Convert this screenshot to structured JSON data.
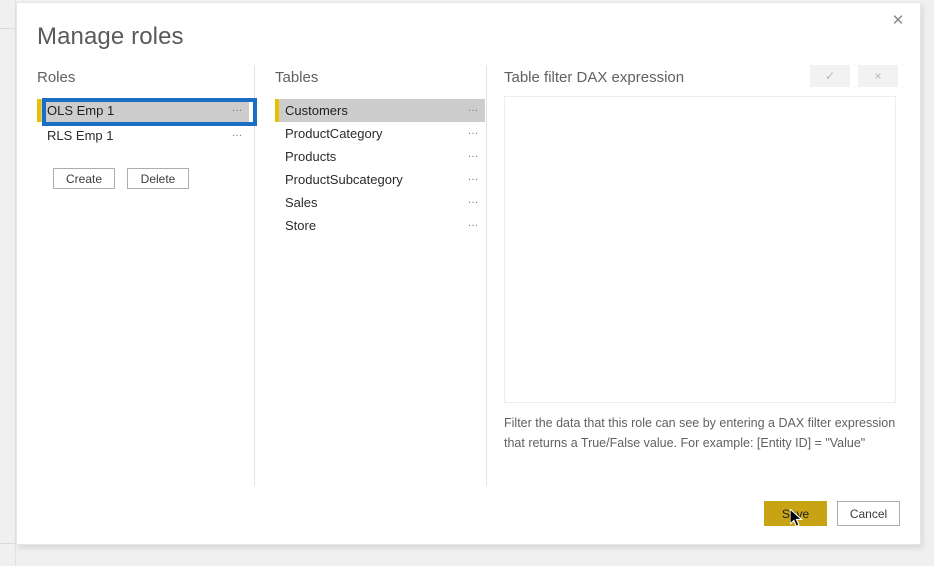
{
  "dialog": {
    "title": "Manage roles",
    "close_icon": "close-icon",
    "close_label": "✕"
  },
  "roles_panel": {
    "header": "Roles",
    "items": [
      {
        "label": "OLS Emp 1",
        "selected": true,
        "menu": "…"
      },
      {
        "label": "RLS Emp 1",
        "selected": false,
        "menu": "…"
      }
    ],
    "buttons": {
      "create": "Create",
      "delete": "Delete"
    }
  },
  "tables_panel": {
    "header": "Tables",
    "items": [
      {
        "label": "Customers",
        "selected": true,
        "menu": "…"
      },
      {
        "label": "ProductCategory",
        "selected": false,
        "menu": "…"
      },
      {
        "label": "Products",
        "selected": false,
        "menu": "…"
      },
      {
        "label": "ProductSubcategory",
        "selected": false,
        "menu": "…"
      },
      {
        "label": "Sales",
        "selected": false,
        "menu": "…"
      },
      {
        "label": "Store",
        "selected": false,
        "menu": "…"
      }
    ]
  },
  "dax_panel": {
    "header": "Table filter DAX expression",
    "accept_label": "✓",
    "accept_icon": "checkmark-icon",
    "reject_label": "×",
    "reject_icon": "close-icon",
    "expression_value": "",
    "expression_placeholder": "",
    "help_line1": "Filter the data that this role can see by entering a DAX filter expression",
    "help_line2": "that returns a True/False value. For example: [Entity ID] = \"Value\""
  },
  "footer": {
    "save": "Save",
    "cancel": "Cancel"
  },
  "colors": {
    "accent_yellow": "#e8c000",
    "selected_row_bg": "#cdcdcd",
    "annotation_blue": "#1a6fc4",
    "primary_button": "#c8a415",
    "title_text": "#5a5a5a",
    "header_text": "#616161"
  }
}
